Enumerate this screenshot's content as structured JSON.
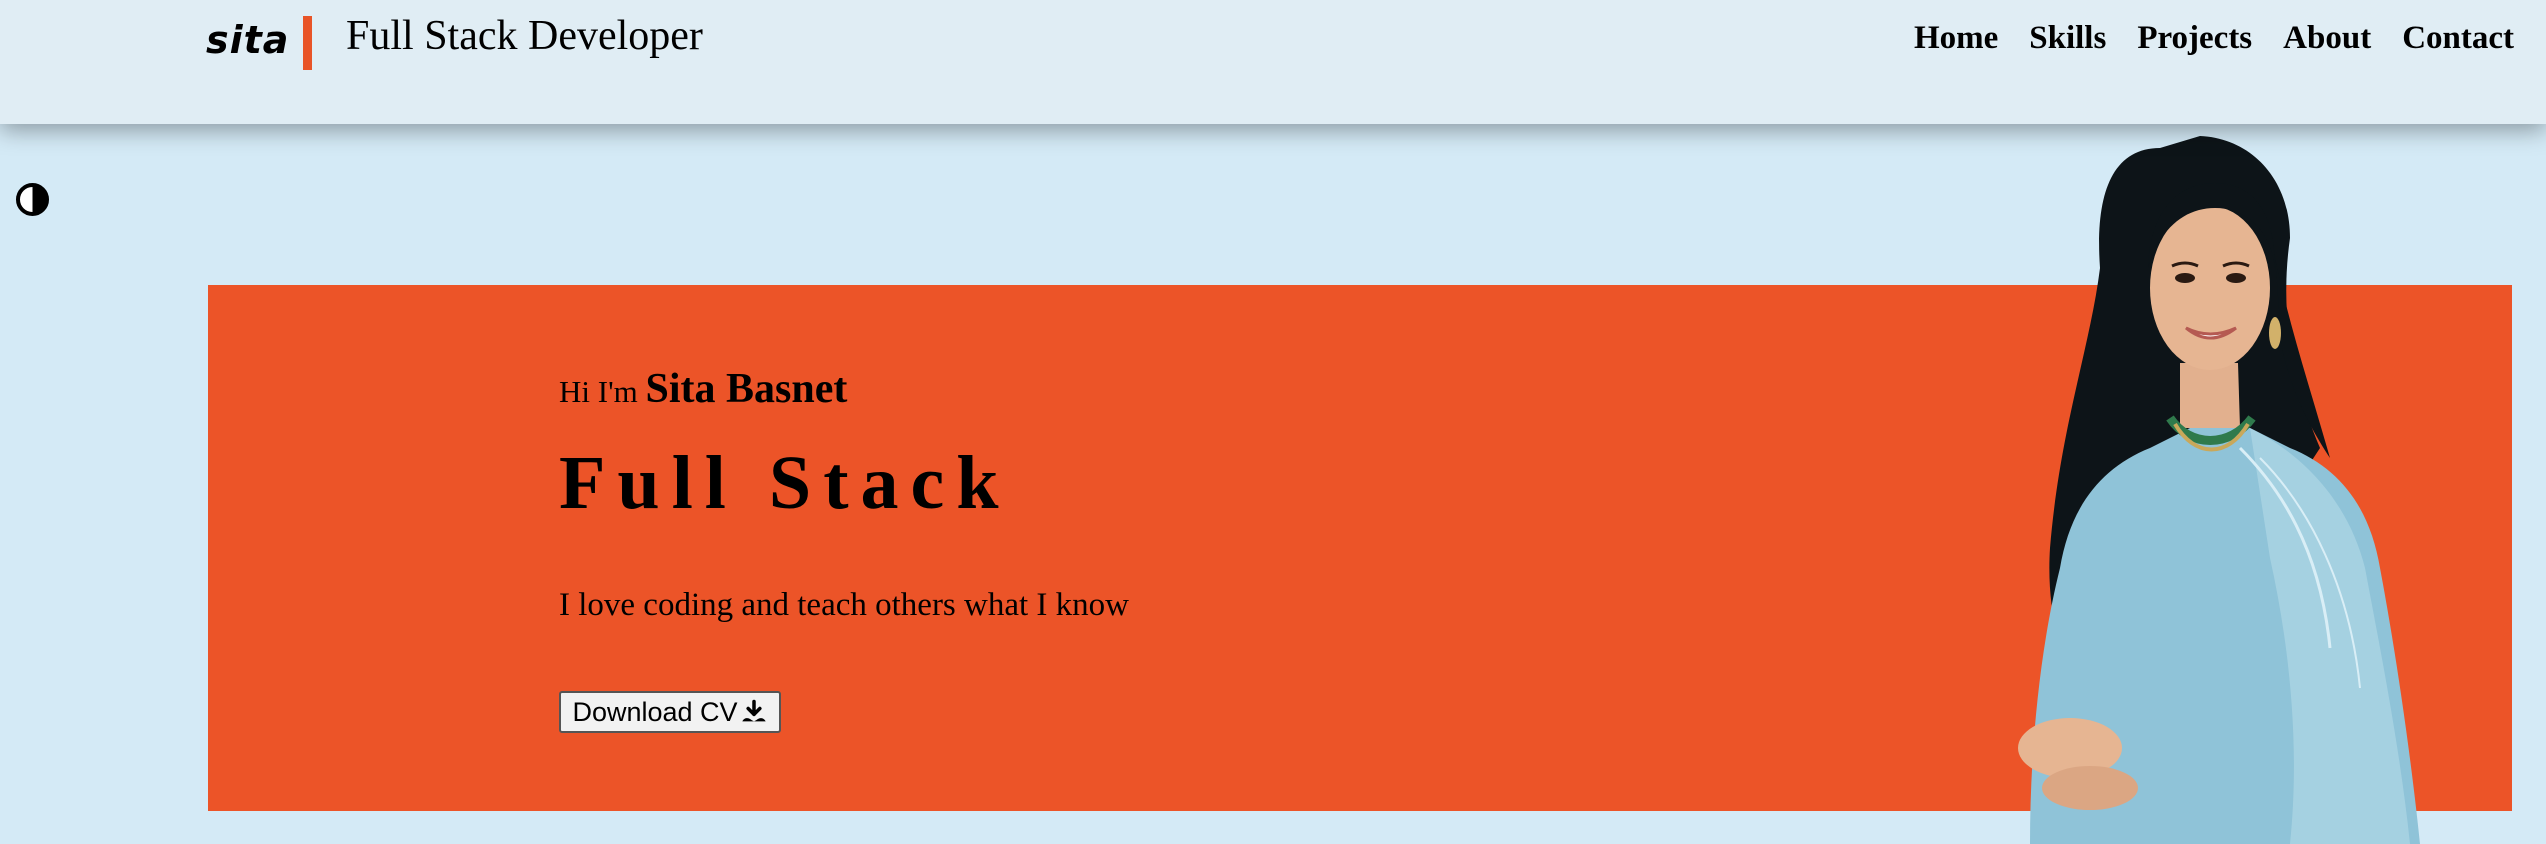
{
  "header": {
    "logo": "sita",
    "title": "Full Stack Developer",
    "nav": [
      "Home",
      "Skills",
      "Projects",
      "About",
      "Contact"
    ]
  },
  "hero": {
    "greeting_prefix": "Hi I'm",
    "name": "Sita Basnet",
    "role": "Full Stack",
    "tagline": "I love coding and teach others what I know",
    "cv_button": "Download CV"
  },
  "colors": {
    "accent": "#ec5428",
    "background": "#d4eaf6",
    "header": "#e0edf4"
  },
  "icons": {
    "theme_toggle": "half-circle-contrast-icon",
    "download": "download-icon"
  }
}
